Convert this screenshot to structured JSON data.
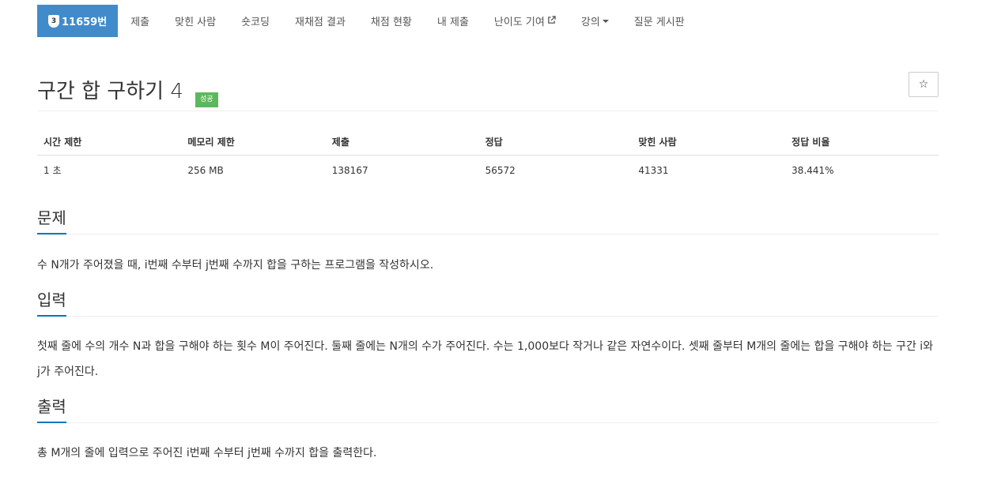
{
  "tabs": [
    {
      "label": "11659번",
      "tier": "3"
    },
    {
      "label": "제출"
    },
    {
      "label": "맞힌 사람"
    },
    {
      "label": "숏코딩"
    },
    {
      "label": "재채점 결과"
    },
    {
      "label": "채점 현황"
    },
    {
      "label": "내 제출"
    },
    {
      "label": "난이도 기여"
    },
    {
      "label": "강의"
    },
    {
      "label": "질문 게시판"
    }
  ],
  "problem": {
    "title": "구간 합 구하기 4",
    "badge": "성공",
    "star": "☆"
  },
  "info": {
    "headers": [
      "시간 제한",
      "메모리 제한",
      "제출",
      "정답",
      "맞힌 사람",
      "정답 비율"
    ],
    "values": [
      "1 초",
      "256 MB",
      "138167",
      "56572",
      "41331",
      "38.441%"
    ]
  },
  "sections": {
    "problem": {
      "title": "문제",
      "text": "수 N개가 주어졌을 때, i번째 수부터 j번째 수까지 합을 구하는 프로그램을 작성하시오."
    },
    "input": {
      "title": "입력",
      "text": "첫째 줄에 수의 개수 N과 합을 구해야 하는 횟수 M이 주어진다. 둘째 줄에는 N개의 수가 주어진다. 수는 1,000보다 작거나 같은 자연수이다. 셋째 줄부터 M개의 줄에는 합을 구해야 하는 구간 i와 j가 주어진다."
    },
    "output": {
      "title": "출력",
      "text": "총 M개의 줄에 입력으로 주어진 i번째 수부터 j번째 수까지 합을 출력한다."
    }
  },
  "colors": {
    "accent": "#428bca",
    "success": "#5cb85c",
    "underline": "#0076c0"
  }
}
